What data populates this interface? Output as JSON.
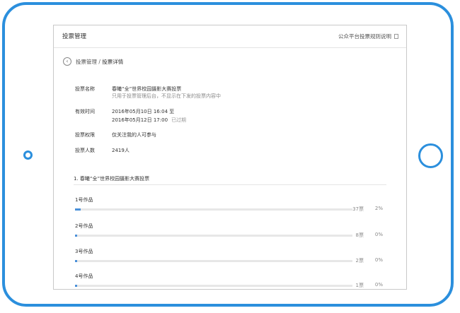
{
  "header": {
    "title": "投票管理",
    "help_label": "公众平台投票规则说明"
  },
  "breadcrumb": {
    "parent": "投票管理",
    "separator": " / ",
    "current": "投票详情"
  },
  "info": {
    "name_label": "投票名称",
    "name_value": "春曦“全”世界校园摄影大赛投票",
    "name_note": "只用于投票管理后台，不显示在下发的投票内容中",
    "time_label": "有效时间",
    "time_start": "2016年05月10日 16:04 至",
    "time_end": "2016年05月12日 17:00",
    "time_status": "已过期",
    "perm_label": "投票权限",
    "perm_value": "仅关注我的人可参与",
    "count_label": "投票人数",
    "count_value": "2419人"
  },
  "question": {
    "title": "1. 春曦“全”世界校园摄影大赛投票",
    "options": [
      {
        "name": "1号作品",
        "votes": "37票",
        "percent_label": "2%",
        "fraction": 0.02
      },
      {
        "name": "2号作品",
        "votes": "8票",
        "percent_label": "0%",
        "fraction": 0.0
      },
      {
        "name": "3号作品",
        "votes": "2票",
        "percent_label": "0%",
        "fraction": 0.0
      },
      {
        "name": "4号作品",
        "votes": "1票",
        "percent_label": "0%",
        "fraction": 0.0
      }
    ]
  },
  "colors": {
    "accent": "#2b8fdd",
    "bar_fill": "#4a90d9"
  }
}
